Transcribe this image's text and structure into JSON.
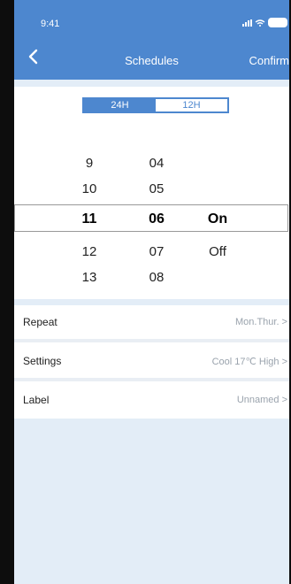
{
  "status": {
    "time": "9:41"
  },
  "header": {
    "title": "Schedules",
    "confirm_label": "Confirm"
  },
  "mode_toggle": {
    "options": [
      "24H",
      "12H"
    ],
    "selected": "24H"
  },
  "picker": {
    "hours": [
      "9",
      "10",
      "11",
      "12",
      "13"
    ],
    "minutes": [
      "04",
      "05",
      "06",
      "07",
      "08"
    ],
    "states": [
      "On",
      "Off"
    ],
    "selected": {
      "hour": "11",
      "minute": "06",
      "state": "On"
    }
  },
  "settings": [
    {
      "label": "Repeat",
      "value": "Mon.Thur. >"
    },
    {
      "label": "Settings",
      "value": "Cool 17℃ High >"
    },
    {
      "label": "Label",
      "value": "Unnamed >"
    }
  ],
  "colors": {
    "accent": "#4d87cf",
    "background": "#e3edf7"
  }
}
